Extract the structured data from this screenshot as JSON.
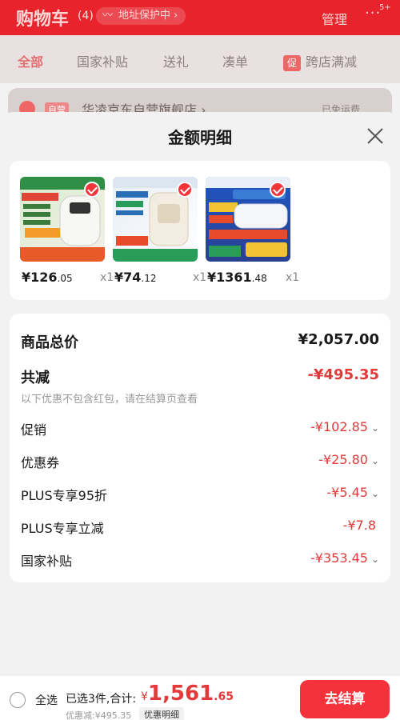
{
  "header": {
    "title": "购物车",
    "count": "(4)",
    "address_protection": "地址保护中 ›",
    "manage": "管理",
    "more_icon": "more-icon",
    "message_badge": "5+"
  },
  "background_tabs": [
    "全部",
    "国家补贴",
    "送礼",
    "凑单",
    "跨店满减"
  ],
  "background_promo_tag": "促",
  "background_store": {
    "tag": "自营",
    "name": "华凌京东自营旗舰店 ›",
    "shipping": "已免运费"
  },
  "sheet": {
    "title": "金额明细",
    "close_icon": "close-icon"
  },
  "products": [
    {
      "price_int": "¥126",
      "price_dec": ".05",
      "qty": "x1",
      "thumb_color": "#c7e0b8"
    },
    {
      "price_int": "¥74",
      "price_dec": ".12",
      "qty": "x1",
      "thumb_color": "#e6ecf3"
    },
    {
      "price_int": "¥1361",
      "price_dec": ".48",
      "qty": "x1",
      "thumb_color": "#1f4fb5"
    }
  ],
  "summary": {
    "subtotal_label": "商品总价",
    "subtotal_value": "¥2,057.00",
    "total_discount_label": "共减",
    "total_discount_value": "-¥495.35",
    "note": "以下优惠不包含红包，请在结算页查看",
    "items": [
      {
        "label": "促销",
        "value": "-¥102.85",
        "chev": "⌄"
      },
      {
        "label": "优惠券",
        "value": "-¥25.80",
        "chev": "⌄"
      },
      {
        "label": "PLUS专享95折",
        "value": "-¥5.45",
        "chev": "⌄"
      },
      {
        "label": "PLUS专享立减",
        "value": "-¥7.8",
        "chev": ""
      },
      {
        "label": "国家补贴",
        "value": "-¥353.45",
        "chev": "⌄"
      }
    ]
  },
  "bottom": {
    "select_all": "全选",
    "selected_text": "已选3件,合计:",
    "currency": "¥",
    "total_int": "1,561",
    "total_dec": ".65",
    "discount_text": "优惠减:¥495.35",
    "detail_button": "优惠明细",
    "checkout_button": "去结算"
  },
  "colors": {
    "brand_red": "#e8232c",
    "price_red": "#e23a3a",
    "checkout_red": "#f4323b"
  }
}
